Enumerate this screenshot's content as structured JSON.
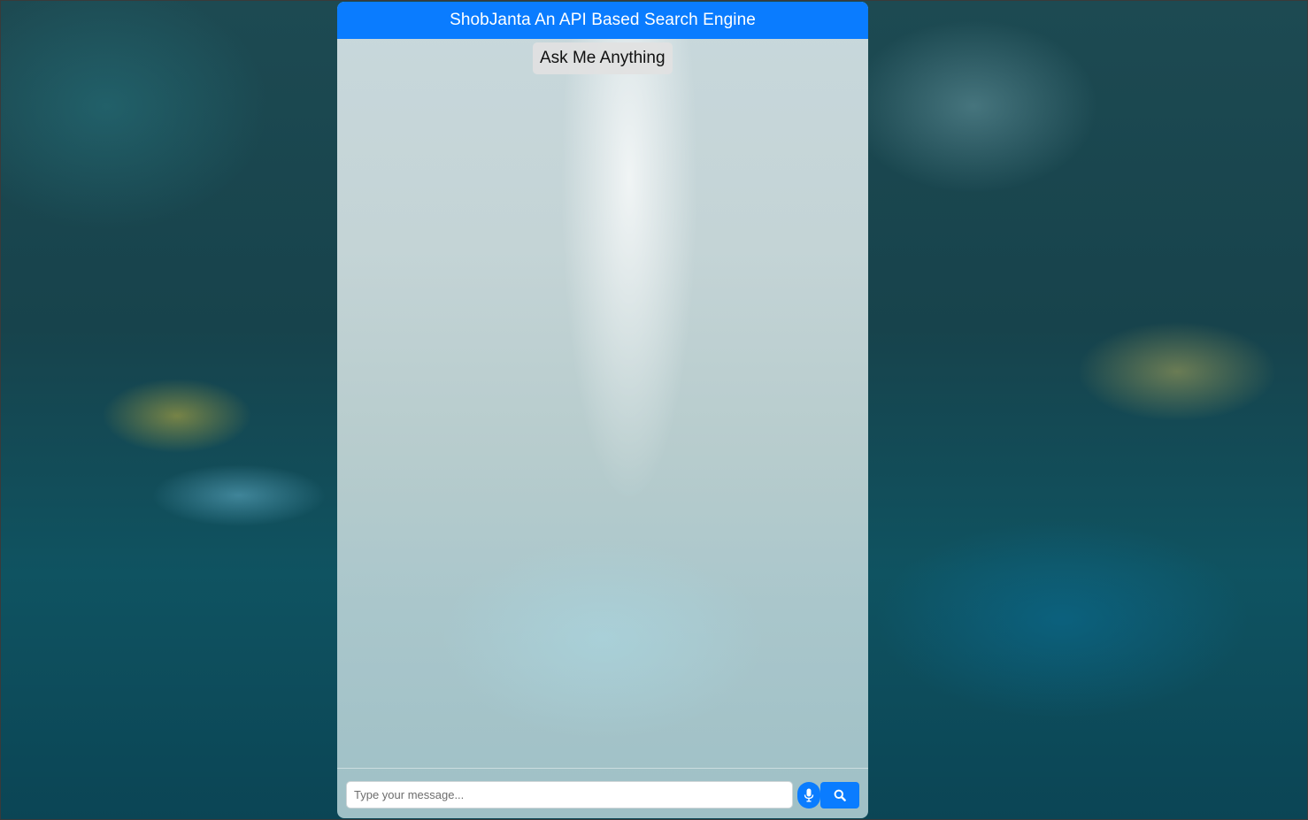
{
  "header": {
    "title": "ShobJanta An API Based Search Engine"
  },
  "messages": [
    {
      "sender": "bot",
      "text": "Ask Me Anything"
    }
  ],
  "composer": {
    "placeholder": "Type your message...",
    "mic_icon": "microphone-icon",
    "send_icon": "search-icon"
  },
  "colors": {
    "accent": "#0a7cff",
    "header_text": "#ffffff",
    "bubble_bg": "#e1e1e1"
  }
}
